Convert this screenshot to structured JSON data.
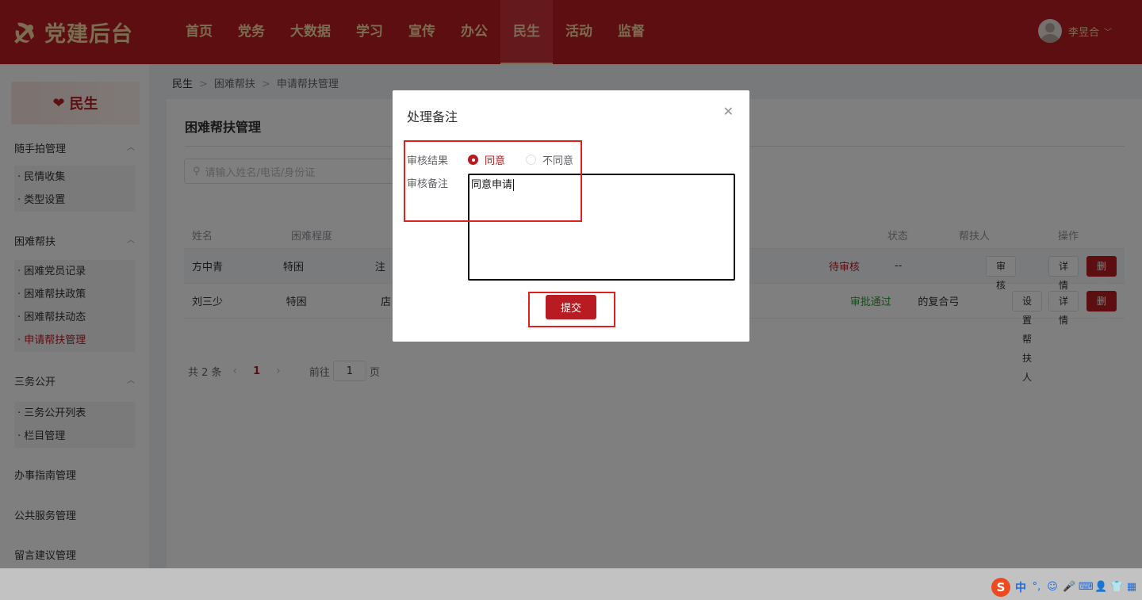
{
  "app": {
    "title": "党建后台"
  },
  "nav": {
    "items": [
      "首页",
      "党务",
      "大数据",
      "学习",
      "宣传",
      "办公",
      "民生",
      "活动",
      "监督"
    ],
    "active_index": 6
  },
  "user": {
    "name": "李昱合"
  },
  "sidebar": {
    "banner": "民生",
    "groups": [
      {
        "title": "随手拍管理",
        "items": [
          "民情收集",
          "类型设置"
        ]
      },
      {
        "title": "困难帮扶",
        "items": [
          "困难党员记录",
          "困难帮扶政策",
          "困难帮扶动态",
          "申请帮扶管理"
        ]
      },
      {
        "title": "三务公开",
        "items": [
          "三务公开列表",
          "栏目管理"
        ]
      }
    ],
    "links": [
      "办事指南管理",
      "公共服务管理",
      "留言建议管理"
    ]
  },
  "breadcrumb": [
    "民生",
    "困难帮扶",
    "申请帮扶管理"
  ],
  "page": {
    "title": "困难帮扶管理"
  },
  "search": {
    "placeholder": "请输入姓名/电话/身份证"
  },
  "table": {
    "headers": [
      "姓名",
      "困难程度",
      "状态",
      "帮扶人",
      "操作"
    ],
    "rows": [
      {
        "name": "方中青",
        "level": "特困",
        "third": "注",
        "status": "待审核",
        "helper": "--",
        "ops": [
          "审核",
          "详情",
          "删除"
        ]
      },
      {
        "name": "刘三少",
        "level": "特困",
        "third": "店",
        "status": "审批通过",
        "helper": "的复合弓",
        "ops": [
          "设置帮扶人",
          "详情",
          "删除"
        ]
      }
    ]
  },
  "pager": {
    "total": "共 2 条",
    "current": "1",
    "goto_label": "前往",
    "goto_value": "1",
    "page_suffix": "页"
  },
  "dialog": {
    "title": "处理备注",
    "result_label": "审核结果",
    "agree": "同意",
    "disagree": "不同意",
    "remark_label": "审核备注",
    "remark_value": "同意申请",
    "submit": "提交"
  },
  "ime": {
    "lang": "中"
  },
  "colors": {
    "brand": "#b81c22",
    "gold": "#f7d9a4",
    "pass": "#2e9b36",
    "highlight": "#e02020"
  }
}
